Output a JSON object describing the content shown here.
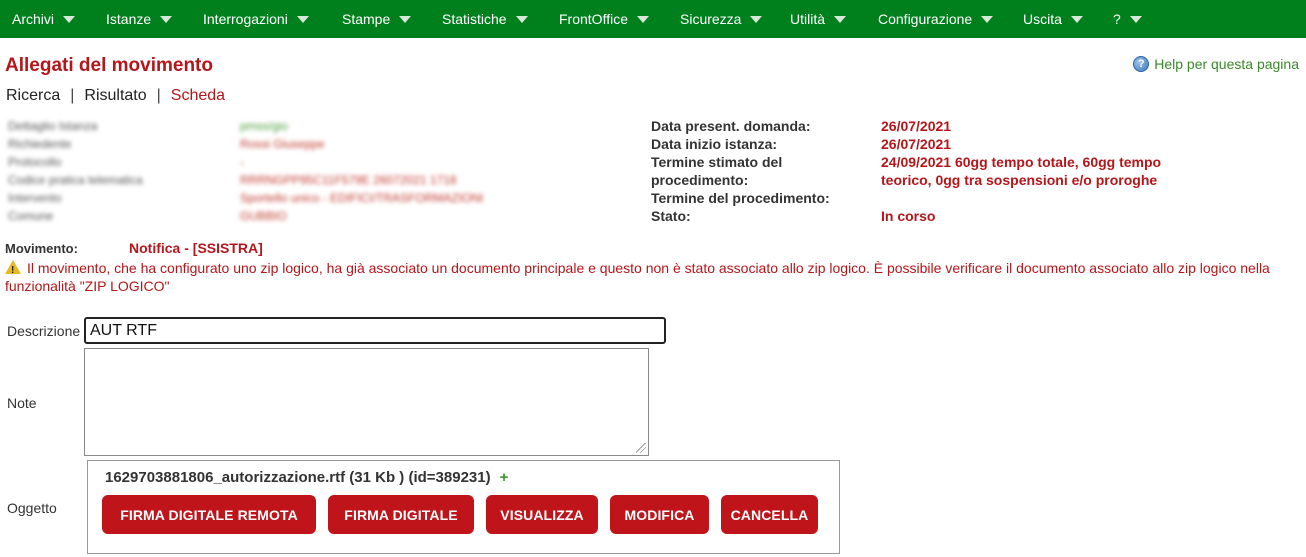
{
  "menu": {
    "items": [
      {
        "label": "Archivi"
      },
      {
        "label": "Istanze"
      },
      {
        "label": "Interrogazioni"
      },
      {
        "label": "Stampe"
      },
      {
        "label": "Statistiche"
      },
      {
        "label": "FrontOffice"
      },
      {
        "label": "Sicurezza"
      },
      {
        "label": "Utilità"
      },
      {
        "label": "Configurazione"
      },
      {
        "label": "Uscita"
      },
      {
        "label": "?"
      }
    ]
  },
  "page": {
    "title": "Allegati del movimento",
    "help_label": "Help per questa pagina",
    "help_icon": "help-icon"
  },
  "breadcrumb": {
    "items": [
      "Ricerca",
      "Risultato",
      "Scheda"
    ],
    "separator": "|"
  },
  "detail_left": {
    "rows": [
      {
        "label": "Dettaglio Istanza",
        "value": "pmss/gio"
      },
      {
        "label": "Richiedente",
        "value": "Rossi Giuseppe"
      },
      {
        "label": "Protocollo",
        "value": "-"
      },
      {
        "label": "Codice pratica telematica",
        "value": "RRRNGPP95C11F579E 26072021 1718"
      },
      {
        "label": "Intervento",
        "value": "Sportello unico - EDIFICI/TRASFORMAZIONI"
      },
      {
        "label": "Comune",
        "value": "GUBBIO"
      }
    ]
  },
  "detail_right": {
    "rows": [
      {
        "label": "Data present. domanda:",
        "value": "26/07/2021"
      },
      {
        "label": "Data inizio istanza:",
        "value": "26/07/2021"
      },
      {
        "label": "Termine stimato del",
        "value": "24/09/2021  60gg tempo totale, 60gg tempo"
      },
      {
        "label": "procedimento:",
        "value": "teorico, 0gg tra sospensioni e/o proroghe"
      },
      {
        "label": "Termine del procedimento:",
        "value": ""
      },
      {
        "label": "Stato:",
        "value": "In corso"
      }
    ]
  },
  "movimento": {
    "label": "Movimento:",
    "value": "Notifica - [SSISTRA]"
  },
  "warning": {
    "icon": "warning-icon",
    "text": "Il movimento, che ha configurato uno zip logico, ha già associato un documento principale e questo non è stato associato allo zip logico. È possibile verificare il documento associato allo zip logico nella funzionalità \"ZIP LOGICO\""
  },
  "form": {
    "descrizione_label": "Descrizione",
    "descrizione_value": "AUT RTF",
    "note_label": "Note",
    "note_value": "",
    "oggetto_label": "Oggetto"
  },
  "oggetto": {
    "file_text": "1629703881806_autorizzazione.rtf (31 Kb ) (id=389231)",
    "plus_label": "+",
    "buttons": {
      "firma_remota": "FIRMA DIGITALE REMOTA",
      "firma": "FIRMA DIGITALE",
      "visualizza": "VISUALIZZA",
      "modifica": "MODIFICA",
      "cancella": "CANCELLA"
    }
  },
  "colors": {
    "menubar": "#00801d",
    "accent_red": "#b5161a",
    "button_red": "#c0141b",
    "help_green": "#3a8a2a"
  }
}
